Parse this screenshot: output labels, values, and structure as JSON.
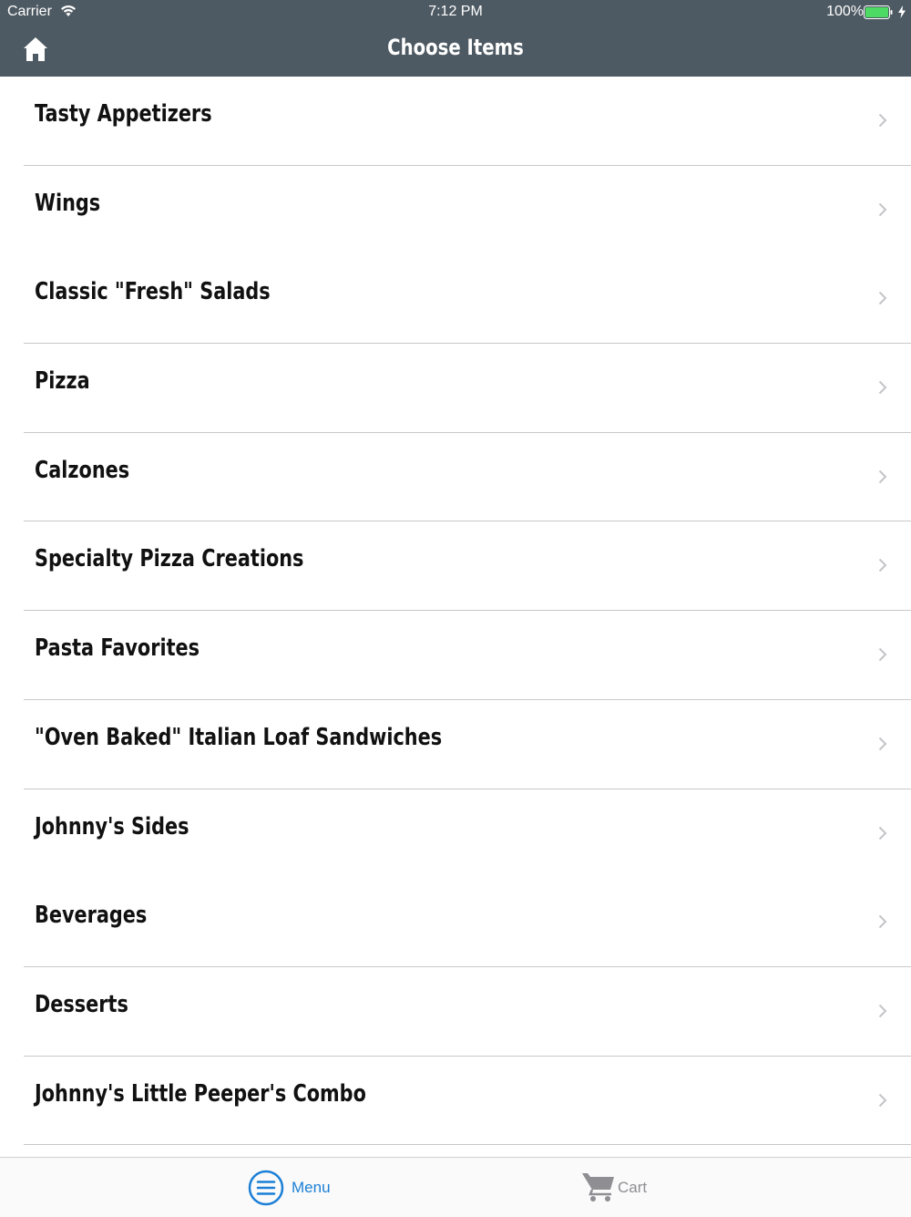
{
  "status_bar": {
    "carrier": "Carrier",
    "time": "7:12 PM",
    "battery": "100%"
  },
  "nav": {
    "title": "Choose Items",
    "home_icon": "home-icon"
  },
  "categories": [
    {
      "label": "Tasty Appetizers"
    },
    {
      "label": "Wings"
    },
    {
      "label": "Classic \"Fresh\" Salads"
    },
    {
      "label": "Pizza"
    },
    {
      "label": "Calzones"
    },
    {
      "label": "Specialty Pizza Creations"
    },
    {
      "label": "Pasta Favorites"
    },
    {
      "label": "\"Oven Baked\" Italian Loaf Sandwiches"
    },
    {
      "label": "Johnny's Sides"
    },
    {
      "label": "Beverages"
    },
    {
      "label": "Desserts"
    },
    {
      "label": "Johnny's Little Peeper's Combo"
    }
  ],
  "tab_bar": {
    "tabs": [
      {
        "label": "Menu",
        "icon": "menu-icon",
        "active": true
      },
      {
        "label": "Cart",
        "icon": "cart-icon",
        "active": false
      }
    ]
  },
  "colors": {
    "bar_bg": "#4e5a63",
    "active_tab": "#1b7fd6",
    "inactive_tab": "#8e8e93",
    "battery": "#4cd964"
  }
}
